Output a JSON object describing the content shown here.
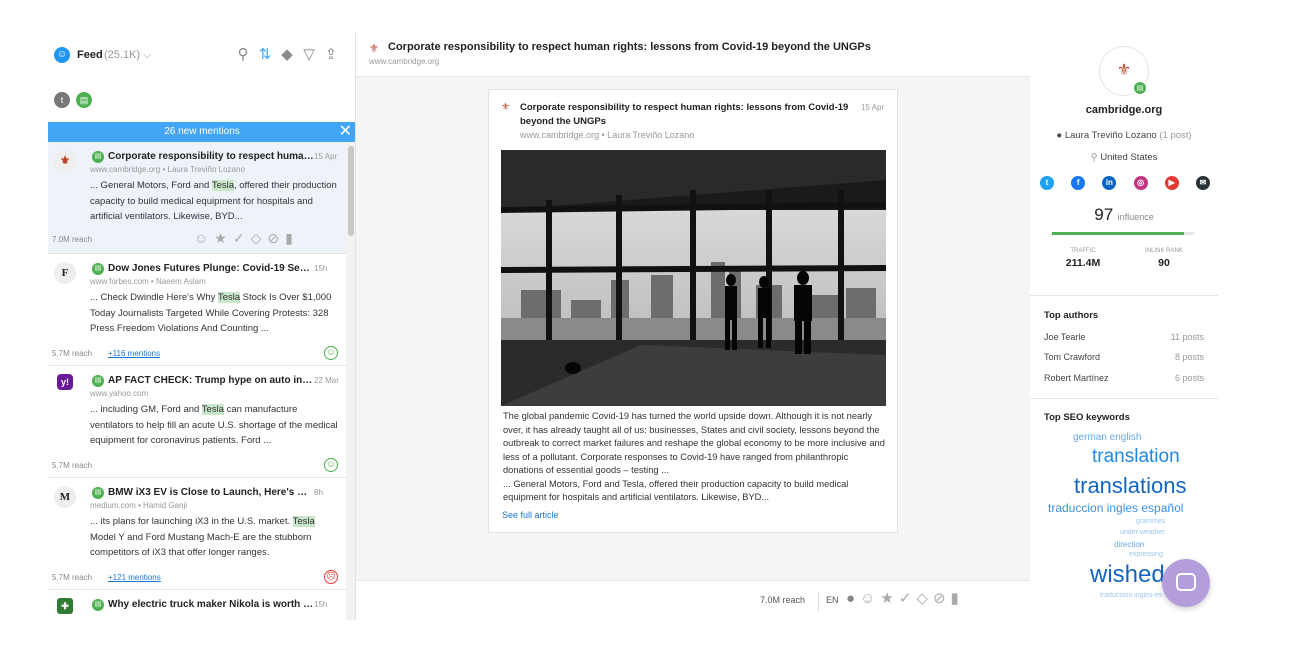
{
  "feed": {
    "title": "Feed",
    "count": "(25.1K)",
    "new_mentions": "26 new mentions",
    "mentions": [
      {
        "title": "Corporate responsibility to respect human...",
        "date": "15 Apr",
        "site": "www.cambridge.org",
        "author": "Laura Treviño Lozano",
        "body_before": "... General Motors, Ford and ",
        "highlight": "Tesla",
        "body_after": ", offered their production capacity to build medical equipment for hospitals and artificial ventilators. Likewise, BYD...",
        "reach": "7.0M reach",
        "link": ""
      },
      {
        "title": "Dow Jones Futures Plunge: Covid-19 Secon...",
        "date": "15h",
        "site": "www.forbes.com",
        "author": "Naeem Aslam",
        "body_before": "... Check Dwindle Here's Why ",
        "highlight": "Tesla",
        "body_after": " Stock Is Over $1,000 Today Journalists Targeted While Covering Protests: 328 Press Freedom Violations And Counting ...",
        "reach": "5.7M reach",
        "link": "+116 mentions"
      },
      {
        "title": "AP FACT CHECK: Trump hype on auto ind...",
        "date": "22 Mar",
        "site": "www.yahoo.com",
        "author": "",
        "body_before": "... including GM, Ford and ",
        "highlight": "Tesla",
        "body_after": " can manufacture ventilators to help fill an acute U.S. shortage of the medical equipment for coronavirus patients. Ford ...",
        "reach": "5.7M reach",
        "link": ""
      },
      {
        "title": "BMW iX3 EV is Close to Launch, Here's What ...",
        "date": "8h",
        "site": "medium.com",
        "author": "Hamid Ganji",
        "body_before": "... its plans for launching iX3 in the U.S. market. ",
        "highlight": "Tesla",
        "body_after": " Model Y and Ford Mustang Mach-E are the stubborn competitors of iX3 that offer longer ranges.",
        "reach": "5.7M reach",
        "link": "+121 mentions"
      },
      {
        "title": "Why electric truck maker Nikola is worth $31...",
        "date": "15h",
        "site": "",
        "author": "",
        "body_before": "",
        "highlight": "",
        "body_after": "",
        "reach": "",
        "link": ""
      }
    ]
  },
  "article": {
    "title": "Corporate responsibility to respect human rights: lessons from Covid-19 beyond the UNGPs",
    "site": "www.cambridge.org",
    "card_title": "Corporate responsibility to respect human rights: lessons from Covid-19 beyond the UNGPs",
    "card_date": "15 Apr",
    "card_meta": "www.cambridge.org • Laura Treviño Lozano",
    "body": "The global pandemic Covid-19 has turned the world upside down. Although it is not nearly over, it has already taught all of us: businesses, States and civil society, lessons beyond the outbreak to correct market failures and reshape the global economy to be more inclusive and less of a pollutant. Corporate responses to Covid-19 have ranged from philanthropic donations of essential goods – testing ...",
    "excerpt": "... General Motors, Ford and Tesla, offered their production capacity to build medical equipment for hospitals and artificial ventilators. Likewise, BYD...",
    "see_full": "See full article",
    "reach": "7.0M reach",
    "lang": "EN"
  },
  "source": {
    "name": "cambridge.org",
    "author": "Laura Treviño Lozano",
    "author_posts": "(1 post)",
    "country": "United States",
    "influence": "97",
    "influence_label": "influence",
    "influence_pct": 0.93,
    "traffic_label": "TRAFFIC",
    "traffic": "211.4M",
    "inlink_label": "INLINK RANK",
    "inlink": "90",
    "top_authors_title": "Top authors",
    "authors": [
      {
        "name": "Joe Tearle",
        "posts": "11 posts"
      },
      {
        "name": "Tom Crawford",
        "posts": "8 posts"
      },
      {
        "name": "Robert Martínez",
        "posts": "6 posts"
      }
    ],
    "seo_title": "Top SEO keywords",
    "keywords": [
      "german english",
      "translation",
      "translations",
      "traduccion ingles español",
      "grammes",
      "under weather",
      "direction",
      "expressing",
      "wished",
      "traduccion ingles-es"
    ]
  },
  "colors": {
    "accent": "#42a5f5",
    "positive": "#4caf50",
    "negative": "#e53935",
    "link": "#1976d2"
  }
}
